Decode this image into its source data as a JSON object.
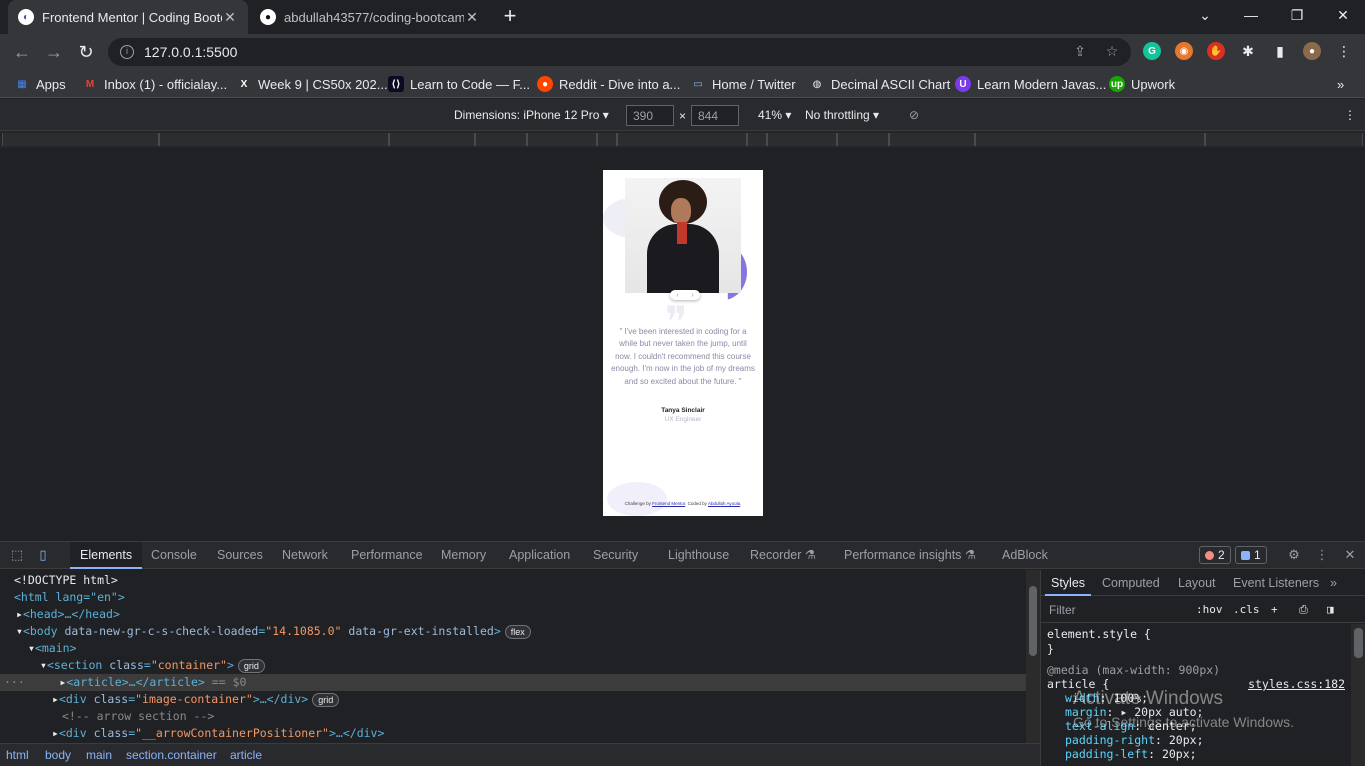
{
  "tabs": [
    {
      "title": "Frontend Mentor | Coding Bootca",
      "favicon": "frontendmentor-icon"
    },
    {
      "title": "abdullah43577/coding-bootcamp",
      "favicon": "github-icon"
    }
  ],
  "address": {
    "url": "127.0.0.1:5500"
  },
  "bookmarks": [
    {
      "label": "Apps"
    },
    {
      "label": "Inbox (1) - officialay..."
    },
    {
      "label": "Week 9 | CS50x 202..."
    },
    {
      "label": "Learn to Code — F..."
    },
    {
      "label": "Reddit - Dive into a..."
    },
    {
      "label": "Home / Twitter"
    },
    {
      "label": "Decimal ASCII Chart"
    },
    {
      "label": "Learn Modern Javas..."
    },
    {
      "label": "Upwork"
    }
  ],
  "device_toolbar": {
    "dimensions_label": "Dimensions: iPhone 12 Pro",
    "width": "390",
    "times": "×",
    "height": "844",
    "zoom": "41%",
    "throttling": "No throttling"
  },
  "preview": {
    "quote": "\" I've been interested in coding for a while but never taken the jump, until now. I couldn't recommend this course enough. I'm now in the job of my dreams and so excited about the future. \"",
    "name": "Tanya Sinclair",
    "role": "UX Engineer",
    "attr_prefix": "Challenge by",
    "attr_fm": "Frontend Mentor",
    "attr_mid": ". Coded by",
    "attr_author": "Abdullah Ayoola",
    "attr_end": "."
  },
  "devtools": {
    "tabs": [
      "Elements",
      "Console",
      "Sources",
      "Network",
      "Performance",
      "Memory",
      "Application",
      "Security",
      "Lighthouse",
      "Recorder",
      "Performance insights",
      "AdBlock"
    ],
    "error_count": "2",
    "message_count": "1",
    "dom": {
      "doctype": "<!DOCTYPE html>",
      "html_open": "<html lang=\"en\">",
      "head": "<head>…</head>",
      "body_attr1": "data-new-gr-c-s-check-loaded",
      "body_val1": "\"14.1085.0\"",
      "body_attr2": "data-gr-ext-installed",
      "body_pill": "flex",
      "main": "<main>",
      "section_class": "\"container\"",
      "section_pill": "grid",
      "article": "<article>…</article>",
      "selected_marker": "== $0",
      "div_class": "\"image-container\"",
      "div_pill": "grid",
      "comment": "<!-- arrow section -->",
      "div2_class": "\"__arrowContainerPositioner\""
    },
    "breadcrumbs": [
      "html",
      "body",
      "main",
      "section.container",
      "article"
    ],
    "styles_tabs": [
      "Styles",
      "Computed",
      "Layout",
      "Event Listeners"
    ],
    "filter_placeholder": "Filter",
    "hov": ":hov",
    "cls": ".cls",
    "rules": {
      "element_style": "element.style {",
      "close": "}",
      "media": "@media (max-width: 900px)",
      "selector": "article {",
      "source": "styles.css:182",
      "props": [
        {
          "name": "width",
          "value": "100%;"
        },
        {
          "name": "margin",
          "value": "20px auto;"
        },
        {
          "name": "text-align",
          "value": "center;"
        },
        {
          "name": "padding-right",
          "value": "20px;"
        },
        {
          "name": "padding-left",
          "value": "20px;"
        }
      ]
    },
    "watermark_title": "Activate Windows",
    "watermark_sub": "Go to Settings to activate Windows."
  }
}
